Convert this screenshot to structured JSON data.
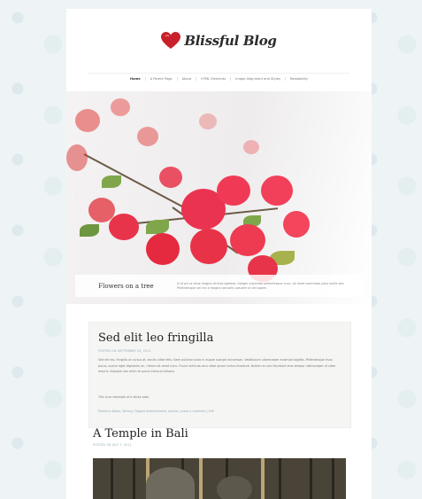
{
  "site": {
    "title": "Blissful Blog"
  },
  "nav": {
    "items": [
      "Home",
      "A Parent Page",
      "About",
      "HTML Elements",
      "Image Alignment and Styles",
      "Readability"
    ]
  },
  "slider": {
    "caption_title": "Flowers on a tree",
    "caption_text": "In id purus vitae magna ultrices egestas. Integer vulputate pellentesque nunc, sit amet commodo justo mollis sed. Pellentesque vel nisi a magna convallis posuere ut vel sapien."
  },
  "posts": [
    {
      "title": "Sed elit leo fringilla",
      "meta": "POSTED ON SEPTEMBER 29, 2011",
      "body": "Sed elit leo, fringilla ut cursus at, iaculis vitae felis. Nam pulvinar justo in augue suscipit accumsan. Vestibulum ullamcorper euismod sagittis. Pellentesque risus purus, auctor eget dignissim ac, rutrum sit amet nunc. Fusce vehicula arcu vitae ipsum luctus tincidunt. Nullam eu orci tincidunt eros tempor ullamcorper ut vitae mauris. Aliquam non enim at purus rhoncus tempus.",
      "sticky": "This is an example of a sticky post.",
      "footer": "Posted in Books, Writing | Tagged entertainment, joomla | Leave a comment | Edit"
    },
    {
      "title": "A Temple in Bali",
      "meta": "POSTED ON JULY 7, 2011"
    }
  ],
  "colors": {
    "heart": "#c8202a",
    "meta": "#93aab0",
    "background": "#eef4f5"
  }
}
